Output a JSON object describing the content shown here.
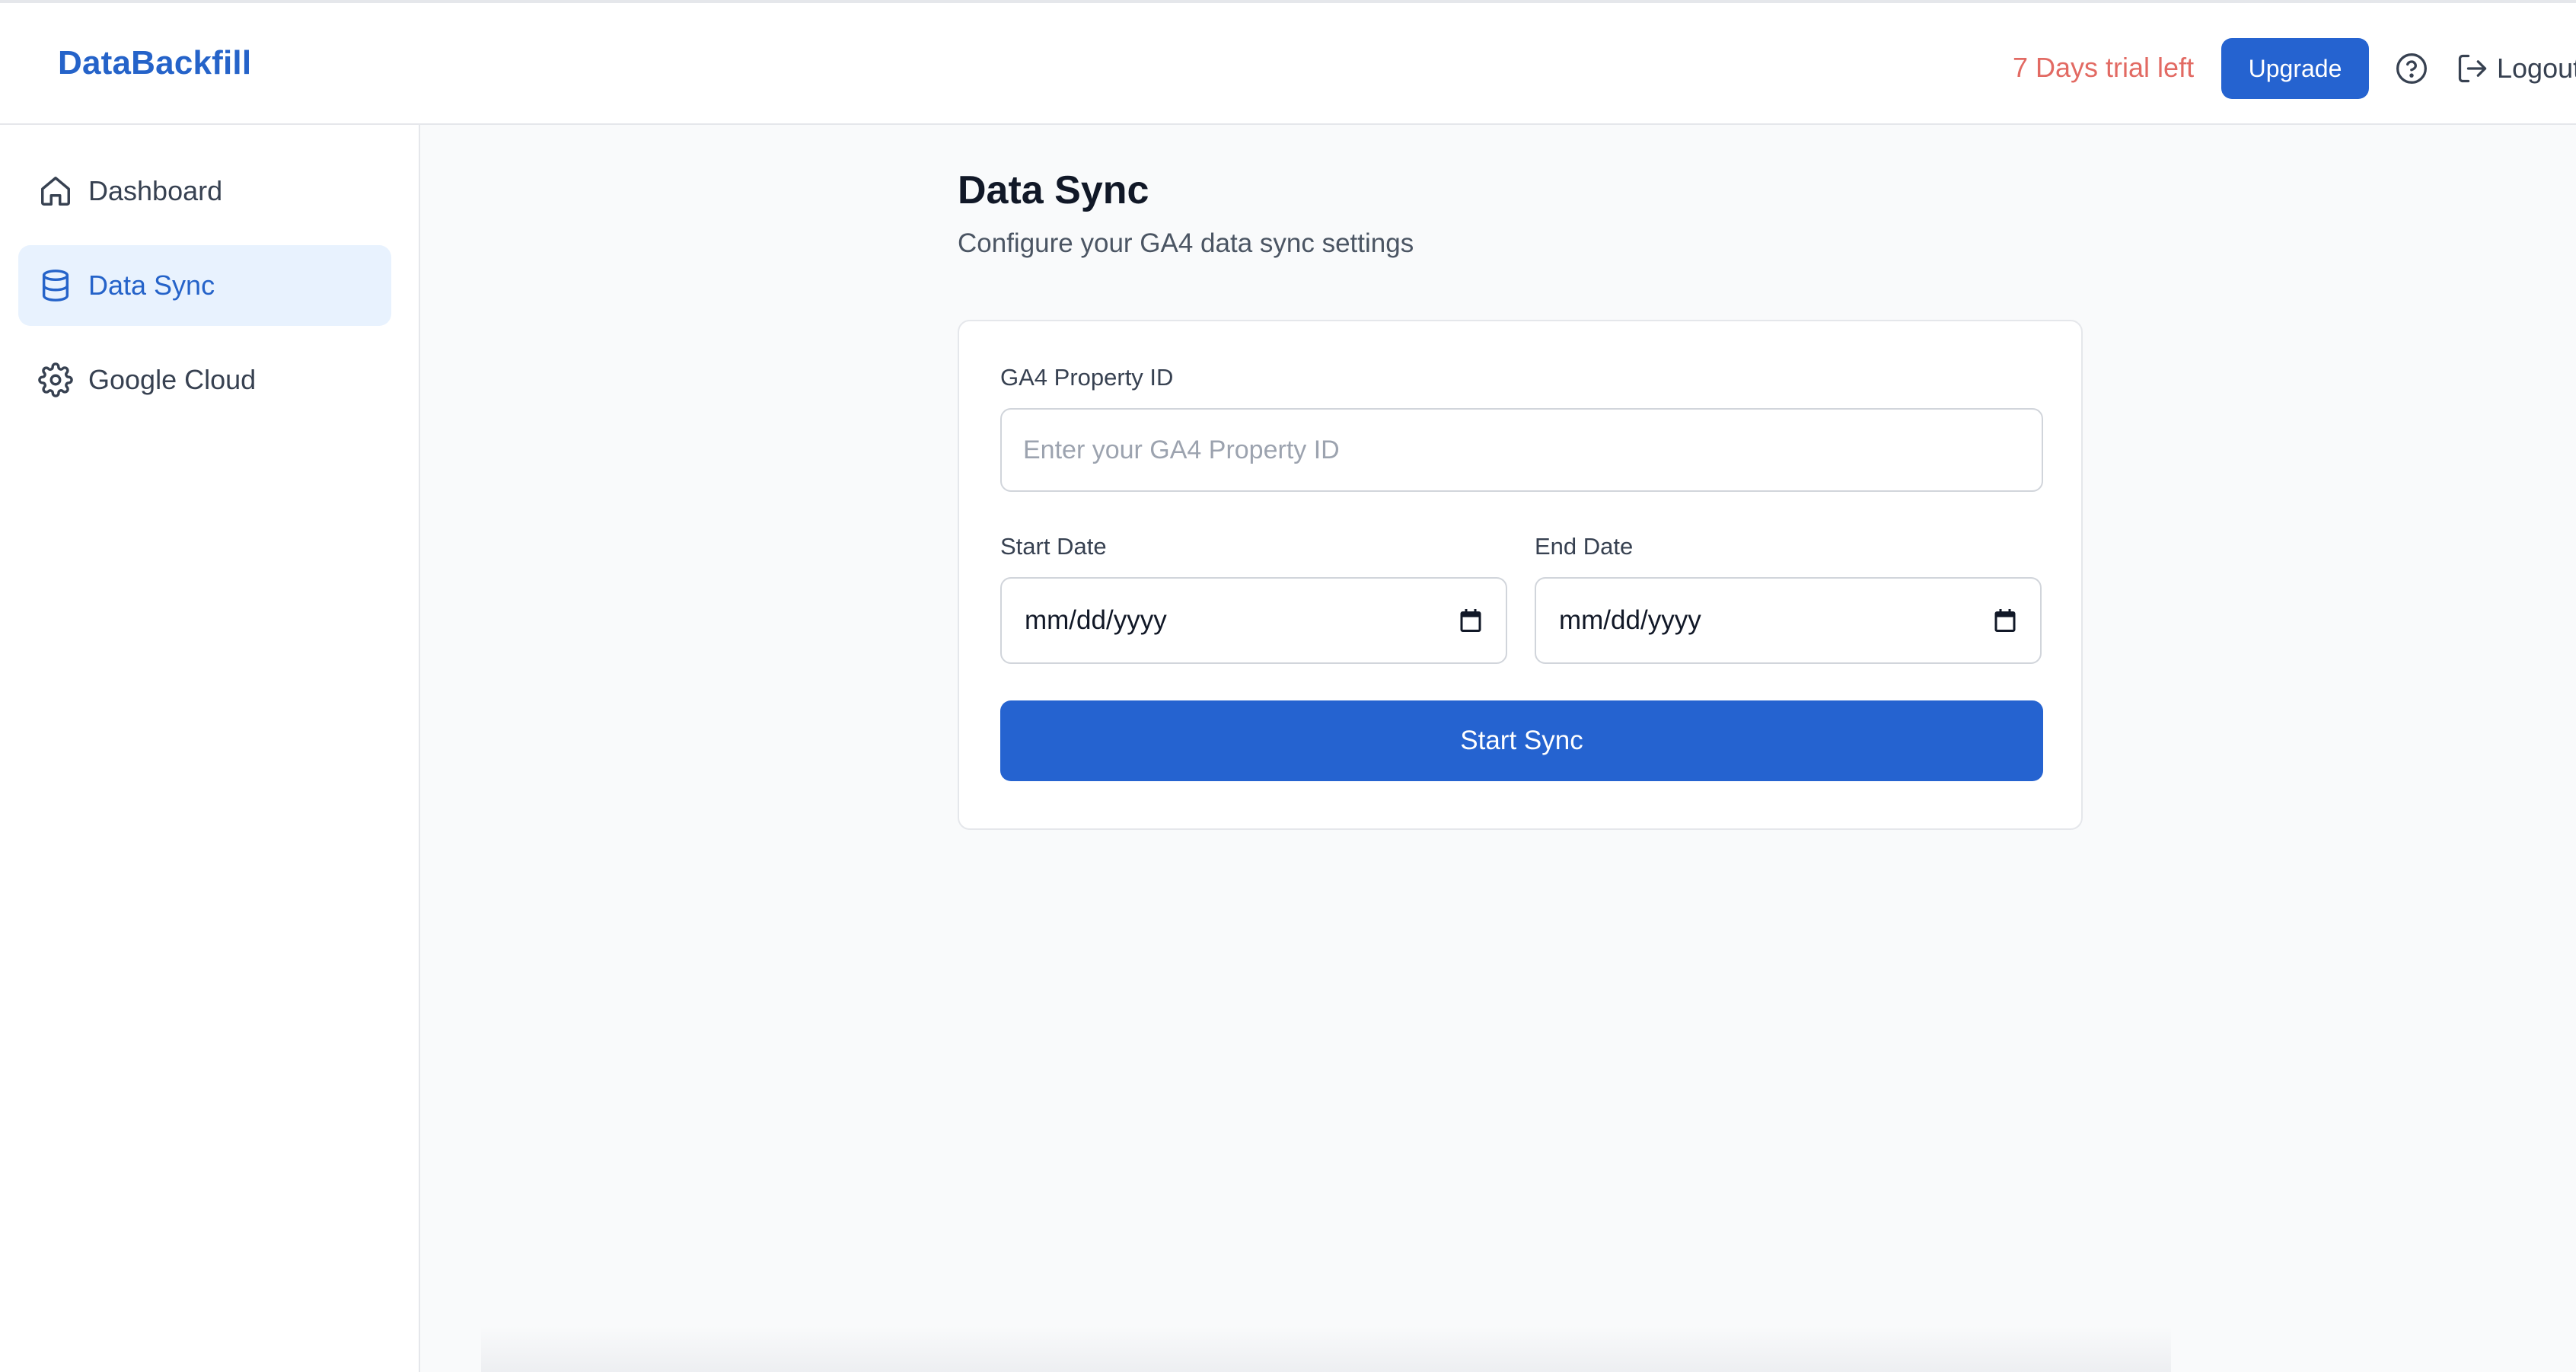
{
  "app": {
    "brand": "DataBackfill"
  },
  "header": {
    "trial_text": "7 Days trial left",
    "upgrade_label": "Upgrade",
    "help_icon": "question-circle-icon",
    "logout_label": "Logout",
    "logout_icon": "logout-icon"
  },
  "sidebar": {
    "items": [
      {
        "label": "Dashboard",
        "icon": "home-icon",
        "active": false
      },
      {
        "label": "Data Sync",
        "icon": "database-icon",
        "active": true
      },
      {
        "label": "Google Cloud",
        "icon": "gear-icon",
        "active": false
      }
    ]
  },
  "main": {
    "title": "Data Sync",
    "subtitle": "Configure your GA4 data sync settings",
    "form": {
      "property_label": "GA4 Property ID",
      "property_value": "",
      "property_placeholder": "Enter your GA4 Property ID",
      "start_label": "Start Date",
      "start_value": "mm/dd/yyyy",
      "end_label": "End Date",
      "end_value": "mm/dd/yyyy",
      "submit_label": "Start Sync"
    }
  },
  "colors": {
    "accent": "#2563d0",
    "brand": "#2563c9",
    "trial": "#e26a63",
    "active_bg": "#e8f2fe"
  }
}
